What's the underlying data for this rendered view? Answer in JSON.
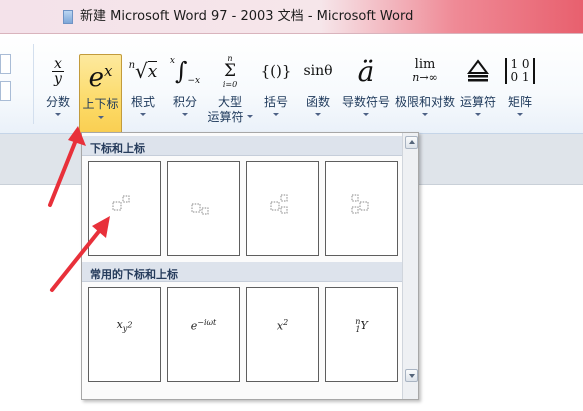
{
  "window": {
    "title": "新建 Microsoft Word 97 - 2003 文档 - Microsoft Word",
    "app_icon": "word-doc-icon"
  },
  "ribbon": {
    "buttons": [
      {
        "name": "fraction",
        "glyph": "x/y",
        "label": "分数"
      },
      {
        "name": "script",
        "glyph": "e^x",
        "label": "上下标",
        "active": true
      },
      {
        "name": "radical",
        "glyph": "ⁿ√x",
        "label": "根式"
      },
      {
        "name": "integral",
        "glyph": "∫",
        "label": "积分"
      },
      {
        "name": "large-operator",
        "glyph": "Σ",
        "label": "大型",
        "label2": "运算符"
      },
      {
        "name": "bracket",
        "glyph": "{()}",
        "label": "括号"
      },
      {
        "name": "function",
        "glyph": "sinθ",
        "label": "函数"
      },
      {
        "name": "accent",
        "glyph": "ä",
        "label": "导数符号"
      },
      {
        "name": "limit-log",
        "glyph": "lim n→∞",
        "label": "极限和对数"
      },
      {
        "name": "operator",
        "glyph": "≜",
        "label": "运算符"
      },
      {
        "name": "matrix",
        "glyph": "[1 0; 0 1]",
        "label": "矩阵"
      }
    ]
  },
  "gallery": {
    "section1_title": "下标和上标",
    "section2_title": "常用的下标和上标",
    "common": [
      {
        "base": "x",
        "sub": "y",
        "subsup": "2"
      },
      {
        "base": "e",
        "sup": "−iωt"
      },
      {
        "base": "x",
        "sup": "2"
      },
      {
        "pre_sup": "n",
        "pre_sub": "1",
        "base": "Y"
      }
    ]
  },
  "colors": {
    "active_button": "#fcd964",
    "annotation_arrow": "#e8303a",
    "section_header": "#dde3ec"
  }
}
